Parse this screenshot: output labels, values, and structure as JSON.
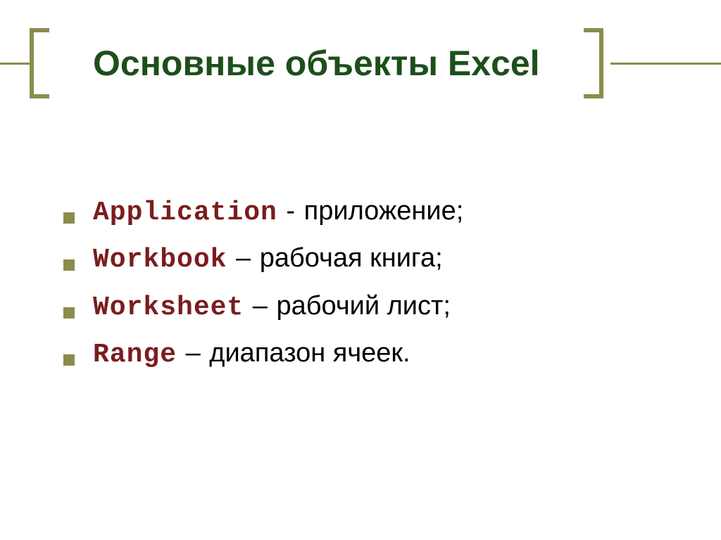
{
  "title": "Основные объекты Excel",
  "items": [
    {
      "term": "Application",
      "sep": " - ",
      "desc": "приложение;"
    },
    {
      "term": "Workbook",
      "sep": " – ",
      "desc": "рабочая книга;"
    },
    {
      "term": "Worksheet",
      "sep": " – ",
      "desc": "рабочий лист;"
    },
    {
      "term": "Range",
      "sep": " – ",
      "desc": "диапазон ячеек."
    }
  ],
  "colors": {
    "accent": "#8c8c4e",
    "title": "#1d4f1a",
    "term": "#7a1d1d"
  }
}
